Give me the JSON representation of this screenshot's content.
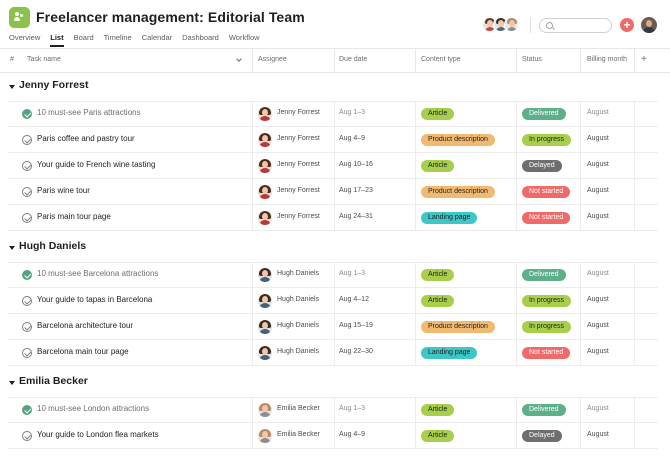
{
  "project": {
    "title": "Freelancer management: Editorial Team",
    "accent_color": "#8bc34a"
  },
  "tabs": [
    {
      "label": "Overview",
      "active": false
    },
    {
      "label": "List",
      "active": true
    },
    {
      "label": "Board",
      "active": false
    },
    {
      "label": "Timeline",
      "active": false
    },
    {
      "label": "Calendar",
      "active": false
    },
    {
      "label": "Dashboard",
      "active": false
    },
    {
      "label": "Workflow",
      "active": false
    }
  ],
  "header_actions": {
    "add_icon": "plus-icon",
    "search_icon": "search-icon"
  },
  "columns": {
    "index": "#",
    "task": "Task name",
    "assignee": "Assignee",
    "due": "Due date",
    "content_type": "Content type",
    "status": "Status",
    "billing": "Billing month",
    "add": "+"
  },
  "colors": {
    "article": "#a7cf4c",
    "product_description": "#f2b970",
    "landing_page": "#3fc7c7",
    "delivered": "#5fb08a",
    "in_progress": "#a7cf4c",
    "delayed": "#6d6e6f",
    "not_started": "#f06a6a",
    "complete_check": "#58a182"
  },
  "sections": [
    {
      "title": "Jenny Forrest",
      "tasks": [
        {
          "name": "10 must-see Paris attractions",
          "done": true,
          "assignee": "Jenny Forrest",
          "due": "Aug 1–3",
          "content_type": "Article",
          "status": "Delivered",
          "billing": "August"
        },
        {
          "name": "Paris coffee and pastry tour",
          "done": false,
          "assignee": "Jenny Forrest",
          "due": "Aug 4–9",
          "content_type": "Product description",
          "status": "In progress",
          "billing": "August"
        },
        {
          "name": "Your guide to French wine tasting",
          "done": false,
          "assignee": "Jenny Forrest",
          "due": "Aug 10–16",
          "content_type": "Article",
          "status": "Delayed",
          "billing": "August"
        },
        {
          "name": "Paris wine tour",
          "done": false,
          "assignee": "Jenny Forrest",
          "due": "Aug 17–23",
          "content_type": "Product description",
          "status": "Not started",
          "billing": "August"
        },
        {
          "name": "Paris main tour page",
          "done": false,
          "assignee": "Jenny Forrest",
          "due": "Aug 24–31",
          "content_type": "Landing page",
          "status": "Not started",
          "billing": "August"
        }
      ]
    },
    {
      "title": "Hugh Daniels",
      "tasks": [
        {
          "name": "10 must-see Barcelona attractions",
          "done": true,
          "assignee": "Hugh Daniels",
          "due": "Aug 1–3",
          "content_type": "Article",
          "status": "Delivered",
          "billing": "August"
        },
        {
          "name": "Your guide to tapas in Barcelona",
          "done": false,
          "assignee": "Hugh Daniels",
          "due": "Aug 4–12",
          "content_type": "Article",
          "status": "In progress",
          "billing": "August"
        },
        {
          "name": "Barcelona architecture tour",
          "done": false,
          "assignee": "Hugh Daniels",
          "due": "Aug 15–19",
          "content_type": "Product description",
          "status": "In progress",
          "billing": "August"
        },
        {
          "name": "Barcelona main tour page",
          "done": false,
          "assignee": "Hugh Daniels",
          "due": "Aug 22–30",
          "content_type": "Landing page",
          "status": "Not started",
          "billing": "August"
        }
      ]
    },
    {
      "title": "Emilia Becker",
      "tasks": [
        {
          "name": "10 must-see London attractions",
          "done": true,
          "assignee": "Emilia Becker",
          "due": "Aug 1–3",
          "content_type": "Article",
          "status": "Delivered",
          "billing": "August"
        },
        {
          "name": "Your guide to London flea markets",
          "done": false,
          "assignee": "Emilia Becker",
          "due": "Aug 4–9",
          "content_type": "Article",
          "status": "Delayed",
          "billing": "August"
        }
      ]
    }
  ]
}
